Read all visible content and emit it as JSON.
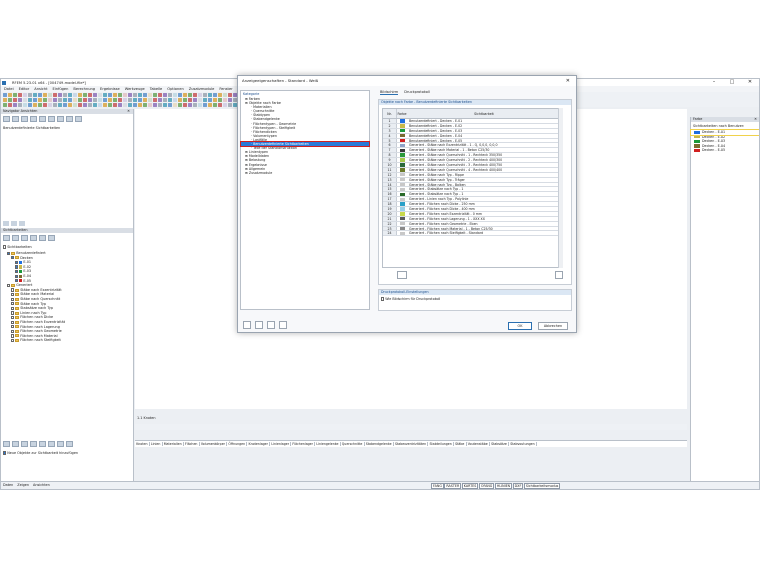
{
  "app": {
    "title": "RFEM 5.23.01 x64 - [004749-model-file*]",
    "ctrl_min": "–",
    "ctrl_max": "□",
    "ctrl_close": "✕"
  },
  "menu": [
    "Datei",
    "Editor",
    "Ansicht",
    "Einfügen",
    "Berechnung",
    "Ergebnisse",
    "Werkzeuge",
    "Tabelle",
    "Optionen",
    "Zusatzmodule",
    "Fenster",
    "Hilfe"
  ],
  "left_panel": {
    "header": "Navigator Ansichten",
    "section1_label": "Ansichten",
    "section2_label": "Sichtbarkeiten",
    "user_section": "Benutzerdefinierte Sichtbarkeiten",
    "tree": [
      {
        "label": "Benutzerdefiniert",
        "level": 1,
        "checked": true,
        "folder": true
      },
      {
        "label": "Decken",
        "level": 2,
        "checked": true,
        "folder": true
      },
      {
        "label": "E-01",
        "level": 3,
        "checked": true,
        "color": "#1f6fe0"
      },
      {
        "label": "E-02",
        "level": 3,
        "checked": true,
        "color": "#c8b94a"
      },
      {
        "label": "E-03",
        "level": 3,
        "checked": true,
        "color": "#1a9a3a"
      },
      {
        "label": "E-04",
        "level": 3,
        "checked": true,
        "color": "#7a6a30"
      },
      {
        "label": "E-05",
        "level": 3,
        "checked": true,
        "color": "#d12020"
      },
      {
        "label": "Generiert",
        "level": 1,
        "checked": false,
        "folder": true
      },
      {
        "label": "Stäbe nach Exzentrizität",
        "level": 2,
        "checked": false,
        "folder": true
      },
      {
        "label": "Stäbe nach Material",
        "level": 2,
        "checked": false,
        "folder": true
      },
      {
        "label": "Stäbe nach Querschnitt",
        "level": 2,
        "checked": false,
        "folder": true
      },
      {
        "label": "Stäbe nach Typ",
        "level": 2,
        "checked": false,
        "folder": true
      },
      {
        "label": "Stabsätze nach Typ",
        "level": 2,
        "checked": false,
        "folder": true
      },
      {
        "label": "Linien nach Typ",
        "level": 2,
        "checked": false,
        "folder": true
      },
      {
        "label": "Flächen nach Dicke",
        "level": 2,
        "checked": false,
        "folder": true
      },
      {
        "label": "Flächen nach Exzentrizität",
        "level": 2,
        "checked": false,
        "folder": true
      },
      {
        "label": "Flächen nach Lagerung",
        "level": 2,
        "checked": false,
        "folder": true
      },
      {
        "label": "Flächen nach Geometrie",
        "level": 2,
        "checked": false,
        "folder": true
      },
      {
        "label": "Flächen nach Material",
        "level": 2,
        "checked": false,
        "folder": true
      },
      {
        "label": "Flächen nach Steifigkeit",
        "level": 2,
        "checked": false,
        "folder": true
      }
    ],
    "add_objects_label": "Neue Objekte zur Sichtbarkeit hinzufügen",
    "bottom_tabs": [
      "Daten",
      "Zeigen",
      "Ansichten"
    ]
  },
  "dialog": {
    "title": "Anzeigeeigenschaften - Standard - Weiß",
    "close": "✕",
    "category_header": "Kategorie",
    "categories": [
      {
        "label": "Farben",
        "level": 0
      },
      {
        "label": "Objekte nach Farbe",
        "level": 0
      },
      {
        "label": "Materialien",
        "level": 1
      },
      {
        "label": "Querschnitte",
        "level": 1
      },
      {
        "label": "Stabtypen",
        "level": 1
      },
      {
        "label": "Stabendgelenke",
        "level": 1
      },
      {
        "label": "Flächentypen - Geometrie",
        "level": 1
      },
      {
        "label": "Flächentypen - Steifigkeit",
        "level": 1
      },
      {
        "label": "Flächendicken",
        "level": 1
      },
      {
        "label": "Volumentypen",
        "level": 1
      },
      {
        "label": "Lastfälle",
        "level": 1
      },
      {
        "label": "Benutzerdefinierte Sichtbarkeiten",
        "level": 1,
        "selected": true
      },
      {
        "label": "Teile der Stahlkonstruktion",
        "level": 1
      },
      {
        "label": "Linientypen",
        "level": 0
      },
      {
        "label": "Modelldaten",
        "level": 0
      },
      {
        "label": "Belastung",
        "level": 0
      },
      {
        "label": "Ergebnisse",
        "level": 0
      },
      {
        "label": "Allgemein",
        "level": 0
      },
      {
        "label": "Zusatzmodule",
        "level": 0
      }
    ],
    "tabs": [
      "Bildschirm",
      "Druckprotokoll"
    ],
    "group1_title": "Objekte nach Farbe - Benutzerdefinierte Sichtbarkeiten",
    "table_headers": [
      "Nr.",
      "Farbe",
      "Sichtbarkeit"
    ],
    "rows": [
      {
        "no": "1",
        "color": "#1f6fe0",
        "label": "Benutzerdefiniert - Decken - E-01"
      },
      {
        "no": "2",
        "color": "#c8b94a",
        "label": "Benutzerdefiniert - Decken - E-02"
      },
      {
        "no": "3",
        "color": "#1a9a3a",
        "label": "Benutzerdefiniert - Decken - E-03"
      },
      {
        "no": "4",
        "color": "#7a6a30",
        "label": "Benutzerdefiniert - Decken - E-04"
      },
      {
        "no": "5",
        "color": "#d12020",
        "label": "Benutzerdefiniert - Decken - E-05"
      },
      {
        "no": "6",
        "color": "#8fa3c8",
        "label": "Generiert - Stäbe nach Exzentrizität - 1 - Q, 0,0,0, 0,0,0"
      },
      {
        "no": "7",
        "color": "#3a3a3a",
        "label": "Generiert - Stäbe nach Material - 1 - Beton C25/30"
      },
      {
        "no": "8",
        "color": "#2a9a3a",
        "label": "Generiert - Stäbe nach Querschnitt - 1 - Rechteck 350/350"
      },
      {
        "no": "9",
        "color": "#a7c84a",
        "label": "Generiert - Stäbe nach Querschnitt - 2 - Rechteck 400/300"
      },
      {
        "no": "10",
        "color": "#2a6a3a",
        "label": "Generiert - Stäbe nach Querschnitt - 3 - Rechteck 400/750"
      },
      {
        "no": "11",
        "color": "#6a7a2a",
        "label": "Generiert - Stäbe nach Querschnitt - 4 - Rechteck 400/400"
      },
      {
        "no": "12",
        "color": "#c8c8c8",
        "label": "Generiert - Stäbe nach Typ - Rippe"
      },
      {
        "no": "13",
        "color": "#c8c8c8",
        "label": "Generiert - Stäbe nach Typ - Träger"
      },
      {
        "no": "14",
        "color": "#c8c8c8",
        "label": "Generiert - Stäbe nach Typ - Balken"
      },
      {
        "no": "15",
        "color": "#c8c8c8",
        "label": "Generiert - Stabsätze nach Typ - 1"
      },
      {
        "no": "16",
        "color": "#2a6a2a",
        "label": "Generiert - Stabsätze nach Typ - 1"
      },
      {
        "no": "17",
        "color": "#c8c8c8",
        "label": "Generiert - Linien nach Typ - Polylinie"
      },
      {
        "no": "18",
        "color": "#2aa0c8",
        "label": "Generiert - Flächen nach Dicke - 250 mm"
      },
      {
        "no": "19",
        "color": "#9ad0e8",
        "label": "Generiert - Flächen nach Dicke - 400 mm"
      },
      {
        "no": "20",
        "color": "#c8d84a",
        "label": "Generiert - Flächen nach Exzentrizität - 0 mm"
      },
      {
        "no": "21",
        "color": "#5a5a5a",
        "label": "Generiert - Flächen nach Lagerung - 1 - XXX XX"
      },
      {
        "no": "22",
        "color": "#c8c8c8",
        "label": "Generiert - Flächen nach Geometrie - Eben"
      },
      {
        "no": "23",
        "color": "#8a8a8a",
        "label": "Generiert - Flächen nach Material - 1 - Beton C25/30"
      },
      {
        "no": "24",
        "color": "#c8c8c8",
        "label": "Generiert - Flächen nach Steifigkeit - Standard"
      }
    ],
    "group2_title": "Druckprotokoll-Einstellungen",
    "group2_checkbox": "Wie Bildschirm für Druckprotokoll",
    "ok": "OK",
    "cancel": "Abbrechen"
  },
  "right_panel": {
    "header": "Farbe",
    "title": "Sichtbarkeiten nach Benutzer:",
    "items": [
      {
        "color": "#1f6fe0",
        "label": "Decken - E-01",
        "selected": true
      },
      {
        "color": "#c8b94a",
        "label": "Decken - E-02"
      },
      {
        "color": "#1a9a3a",
        "label": "Decken - E-03"
      },
      {
        "color": "#7a6a30",
        "label": "Decken - E-04"
      },
      {
        "color": "#d12020",
        "label": "Decken - E-05"
      }
    ]
  },
  "bottom_tabs": [
    "Knoten",
    "Linien",
    "Materialien",
    "Flächen",
    "Volumenkörper",
    "Öffnungen",
    "Knotenlager",
    "Linienlager",
    "Flächenlager",
    "Liniengelenke",
    "Querschnitte",
    "Stabendgelenke",
    "Stabexzentrizitäten",
    "Stabteilungen",
    "Stäbe",
    "Voutenstäbe",
    "Stabsätze",
    "Stabvoutungen"
  ],
  "table_label": "1.1 Knoten",
  "status": [
    "FANG",
    "RASTER",
    "KARTES",
    "OFANG",
    "HLINIEN",
    "DXF",
    "Sichtbarkeitsmodus"
  ]
}
